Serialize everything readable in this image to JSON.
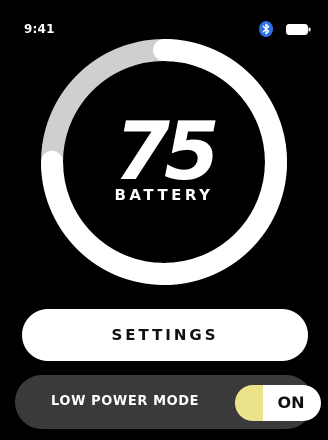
{
  "status_bar": {
    "time": "9:41",
    "bluetooth_icon": "bluetooth-icon",
    "battery_icon": "battery-status-icon"
  },
  "battery": {
    "level": 75,
    "level_text": "75",
    "label": "BATTERY"
  },
  "settings": {
    "label": "SETTINGS"
  },
  "low_power_mode": {
    "label": "LOW POWER MODE",
    "state": "ON",
    "enabled": true
  },
  "colors": {
    "background": "#000000",
    "ring_fill": "#ffffff",
    "ring_track": "#cfcfcf",
    "bluetooth": "#2f6fe4",
    "toggle_accent": "#ece28a",
    "row_background": "#3a3a3a"
  }
}
